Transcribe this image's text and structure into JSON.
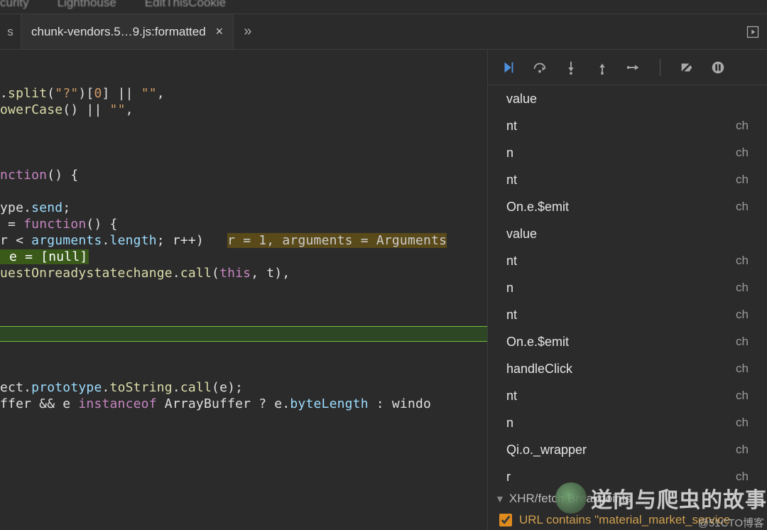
{
  "panelTabs": {
    "t1": "curity",
    "t2": "Lighthouse",
    "t3": "EditThisCookie"
  },
  "fileTab": {
    "stub": "s",
    "name": "chunk-vendors.5…9.js:formatted",
    "close": "×",
    "overflow": "»"
  },
  "code": {
    "l1a": ".",
    "l1b": "split",
    "l1c": "(",
    "l1d": "\"?\"",
    "l1e": ")[",
    "l1f": "0",
    "l1g": "] || ",
    "l1h": "\"\"",
    "l1i": ",",
    "l2a": "owerCase",
    "l2b": "() || ",
    "l2c": "\"\"",
    "l2d": ",",
    "l3a": "nction",
    "l3b": "() {",
    "l4a": "ype.",
    "l4b": "send",
    "l4c": ";",
    "l5a": " = ",
    "l5b": "function",
    "l5c": "() {",
    "l6a": "r < ",
    "l6b": "arguments",
    "l6c": ".",
    "l6d": "length",
    "l6e": "; r++)   ",
    "l6f": "r = 1, arguments = Arguments",
    "l7a": " e = [null]",
    "l8a": "uestOnreadystatechange",
    "l8b": ".",
    "l8c": "call",
    "l8d": "(",
    "l8e": "this",
    "l8f": ", t),",
    "l9a": "ect.",
    "l9b": "prototype",
    "l9c": ".",
    "l9d": "toString",
    "l9e": ".",
    "l9f": "call",
    "l9g": "(e);",
    "l10a": "ffer && e ",
    "l10b": "instanceof",
    "l10c": " ArrayBuffer ? e.",
    "l10d": "byteLength",
    "l10e": " : windo"
  },
  "stack": [
    {
      "f": "value",
      "s": ""
    },
    {
      "f": "nt",
      "s": "ch"
    },
    {
      "f": "n",
      "s": "ch"
    },
    {
      "f": "nt",
      "s": "ch"
    },
    {
      "f": "On.e.$emit",
      "s": "ch"
    },
    {
      "f": "value",
      "s": ""
    },
    {
      "f": "nt",
      "s": "ch"
    },
    {
      "f": "n",
      "s": "ch"
    },
    {
      "f": "nt",
      "s": "ch"
    },
    {
      "f": "On.e.$emit",
      "s": "ch"
    },
    {
      "f": "handleClick",
      "s": "ch"
    },
    {
      "f": "nt",
      "s": "ch"
    },
    {
      "f": "n",
      "s": "ch"
    },
    {
      "f": "Qi.o._wrapper",
      "s": "ch"
    },
    {
      "f": "r",
      "s": "ch"
    }
  ],
  "sections": {
    "xhrHeader": "XHR/fetch Breakpoints",
    "bpLabel": "URL contains \"material_market_service"
  },
  "watermark": {
    "title": "逆向与爬虫的故事",
    "sub": "@51CTO博客"
  }
}
